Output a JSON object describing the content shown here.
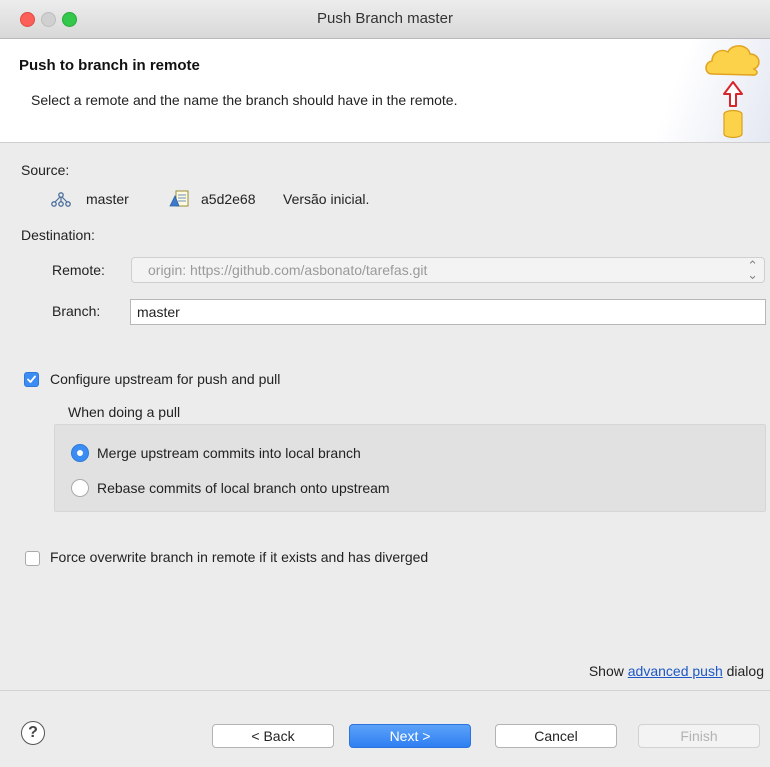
{
  "window": {
    "title": "Push Branch master"
  },
  "banner": {
    "title": "Push to branch in remote",
    "description": "Select a remote and the name the branch should have in the remote.",
    "icon": "cloud-push-icon"
  },
  "source": {
    "label": "Source:",
    "branch": "master",
    "commit_id": "a5d2e68",
    "commit_message": "Versão inicial."
  },
  "destination": {
    "label": "Destination:",
    "remote_label": "Remote:",
    "remote_value": "origin: https://github.com/asbonato/tarefas.git",
    "branch_label": "Branch:",
    "branch_value": "master"
  },
  "upstream": {
    "label": "Configure upstream for push and pull",
    "checked": true,
    "pull_group_label": "When doing a pull",
    "options": [
      {
        "label": "Merge upstream commits into local branch",
        "selected": true
      },
      {
        "label": "Rebase commits of local branch onto upstream",
        "selected": false
      }
    ]
  },
  "force": {
    "label": "Force overwrite branch in remote if it exists and has diverged",
    "checked": false
  },
  "advanced": {
    "prefix": "Show",
    "link": "advanced push",
    "suffix": "dialog"
  },
  "buttons": {
    "help": "?",
    "back": "< Back",
    "next": "Next >",
    "cancel": "Cancel",
    "finish": "Finish"
  },
  "colors": {
    "accent": "#3b8cf3",
    "link": "#1d58c4",
    "close": "#fc5f57",
    "maximize": "#34c84a"
  }
}
